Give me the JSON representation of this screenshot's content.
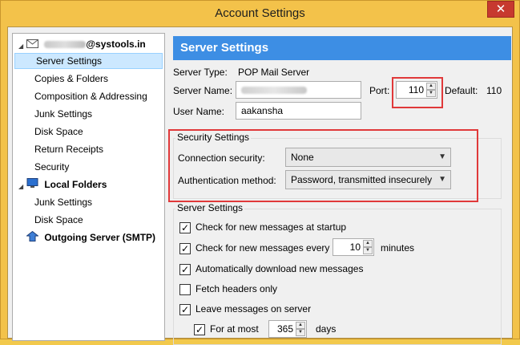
{
  "window": {
    "title": "Account Settings",
    "close_glyph": "✕"
  },
  "sidebar": {
    "account_suffix": "@systools.in",
    "items": [
      {
        "label": "Server Settings"
      },
      {
        "label": "Copies & Folders"
      },
      {
        "label": "Composition & Addressing"
      },
      {
        "label": "Junk Settings"
      },
      {
        "label": "Disk Space"
      },
      {
        "label": "Return Receipts"
      },
      {
        "label": "Security"
      }
    ],
    "local_folders": {
      "label": "Local Folders",
      "items": [
        {
          "label": "Junk Settings"
        },
        {
          "label": "Disk Space"
        }
      ]
    },
    "outgoing": {
      "label": "Outgoing Server (SMTP)"
    }
  },
  "main": {
    "header": "Server Settings",
    "server_type_label": "Server Type:",
    "server_type_value": "POP Mail Server",
    "server_name_label": "Server Name:",
    "port_label": "Port:",
    "port_value": "110",
    "default_label": "Default:",
    "default_value": "110",
    "user_name_label": "User Name:",
    "user_name_value": "aakansha",
    "security": {
      "title": "Security Settings",
      "connection_label": "Connection security:",
      "connection_value": "None",
      "auth_label": "Authentication method:",
      "auth_value": "Password, transmitted insecurely"
    },
    "server_settings": {
      "title": "Server Settings",
      "check_startup": "Check for new messages at startup",
      "check_every": "Check for new messages every",
      "check_every_value": "10",
      "minutes": "minutes",
      "auto_download": "Automatically download new messages",
      "fetch_headers": "Fetch headers only",
      "leave_on_server": "Leave messages on server",
      "for_at_most": "For at most",
      "days_value": "365",
      "days": "days"
    }
  },
  "colors": {
    "header_blue": "#3d8ee4",
    "highlight_red": "#e0393a",
    "window_frame": "#f3c24a"
  }
}
